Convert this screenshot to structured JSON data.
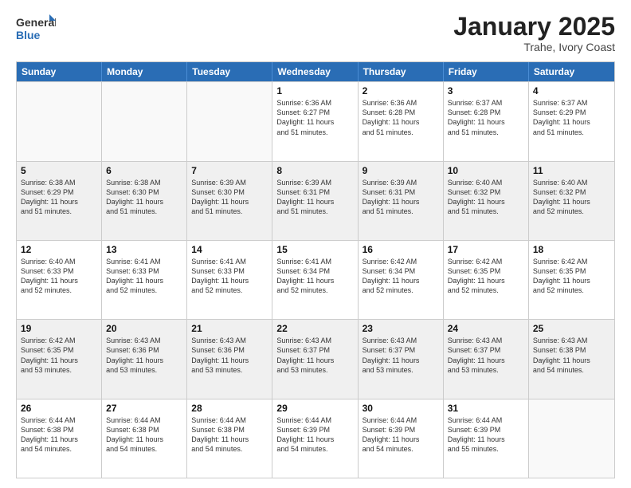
{
  "header": {
    "logo_general": "General",
    "logo_blue": "Blue",
    "month_title": "January 2025",
    "subtitle": "Trahe, Ivory Coast"
  },
  "days_of_week": [
    "Sunday",
    "Monday",
    "Tuesday",
    "Wednesday",
    "Thursday",
    "Friday",
    "Saturday"
  ],
  "weeks": [
    [
      {
        "day": "",
        "lines": [],
        "empty": true
      },
      {
        "day": "",
        "lines": [],
        "empty": true
      },
      {
        "day": "",
        "lines": [],
        "empty": true
      },
      {
        "day": "1",
        "lines": [
          "Sunrise: 6:36 AM",
          "Sunset: 6:27 PM",
          "Daylight: 11 hours",
          "and 51 minutes."
        ]
      },
      {
        "day": "2",
        "lines": [
          "Sunrise: 6:36 AM",
          "Sunset: 6:28 PM",
          "Daylight: 11 hours",
          "and 51 minutes."
        ]
      },
      {
        "day": "3",
        "lines": [
          "Sunrise: 6:37 AM",
          "Sunset: 6:28 PM",
          "Daylight: 11 hours",
          "and 51 minutes."
        ]
      },
      {
        "day": "4",
        "lines": [
          "Sunrise: 6:37 AM",
          "Sunset: 6:29 PM",
          "Daylight: 11 hours",
          "and 51 minutes."
        ]
      }
    ],
    [
      {
        "day": "5",
        "lines": [
          "Sunrise: 6:38 AM",
          "Sunset: 6:29 PM",
          "Daylight: 11 hours",
          "and 51 minutes."
        ]
      },
      {
        "day": "6",
        "lines": [
          "Sunrise: 6:38 AM",
          "Sunset: 6:30 PM",
          "Daylight: 11 hours",
          "and 51 minutes."
        ]
      },
      {
        "day": "7",
        "lines": [
          "Sunrise: 6:39 AM",
          "Sunset: 6:30 PM",
          "Daylight: 11 hours",
          "and 51 minutes."
        ]
      },
      {
        "day": "8",
        "lines": [
          "Sunrise: 6:39 AM",
          "Sunset: 6:31 PM",
          "Daylight: 11 hours",
          "and 51 minutes."
        ]
      },
      {
        "day": "9",
        "lines": [
          "Sunrise: 6:39 AM",
          "Sunset: 6:31 PM",
          "Daylight: 11 hours",
          "and 51 minutes."
        ]
      },
      {
        "day": "10",
        "lines": [
          "Sunrise: 6:40 AM",
          "Sunset: 6:32 PM",
          "Daylight: 11 hours",
          "and 51 minutes."
        ]
      },
      {
        "day": "11",
        "lines": [
          "Sunrise: 6:40 AM",
          "Sunset: 6:32 PM",
          "Daylight: 11 hours",
          "and 52 minutes."
        ]
      }
    ],
    [
      {
        "day": "12",
        "lines": [
          "Sunrise: 6:40 AM",
          "Sunset: 6:33 PM",
          "Daylight: 11 hours",
          "and 52 minutes."
        ]
      },
      {
        "day": "13",
        "lines": [
          "Sunrise: 6:41 AM",
          "Sunset: 6:33 PM",
          "Daylight: 11 hours",
          "and 52 minutes."
        ]
      },
      {
        "day": "14",
        "lines": [
          "Sunrise: 6:41 AM",
          "Sunset: 6:33 PM",
          "Daylight: 11 hours",
          "and 52 minutes."
        ]
      },
      {
        "day": "15",
        "lines": [
          "Sunrise: 6:41 AM",
          "Sunset: 6:34 PM",
          "Daylight: 11 hours",
          "and 52 minutes."
        ]
      },
      {
        "day": "16",
        "lines": [
          "Sunrise: 6:42 AM",
          "Sunset: 6:34 PM",
          "Daylight: 11 hours",
          "and 52 minutes."
        ]
      },
      {
        "day": "17",
        "lines": [
          "Sunrise: 6:42 AM",
          "Sunset: 6:35 PM",
          "Daylight: 11 hours",
          "and 52 minutes."
        ]
      },
      {
        "day": "18",
        "lines": [
          "Sunrise: 6:42 AM",
          "Sunset: 6:35 PM",
          "Daylight: 11 hours",
          "and 52 minutes."
        ]
      }
    ],
    [
      {
        "day": "19",
        "lines": [
          "Sunrise: 6:42 AM",
          "Sunset: 6:35 PM",
          "Daylight: 11 hours",
          "and 53 minutes."
        ]
      },
      {
        "day": "20",
        "lines": [
          "Sunrise: 6:43 AM",
          "Sunset: 6:36 PM",
          "Daylight: 11 hours",
          "and 53 minutes."
        ]
      },
      {
        "day": "21",
        "lines": [
          "Sunrise: 6:43 AM",
          "Sunset: 6:36 PM",
          "Daylight: 11 hours",
          "and 53 minutes."
        ]
      },
      {
        "day": "22",
        "lines": [
          "Sunrise: 6:43 AM",
          "Sunset: 6:37 PM",
          "Daylight: 11 hours",
          "and 53 minutes."
        ]
      },
      {
        "day": "23",
        "lines": [
          "Sunrise: 6:43 AM",
          "Sunset: 6:37 PM",
          "Daylight: 11 hours",
          "and 53 minutes."
        ]
      },
      {
        "day": "24",
        "lines": [
          "Sunrise: 6:43 AM",
          "Sunset: 6:37 PM",
          "Daylight: 11 hours",
          "and 53 minutes."
        ]
      },
      {
        "day": "25",
        "lines": [
          "Sunrise: 6:43 AM",
          "Sunset: 6:38 PM",
          "Daylight: 11 hours",
          "and 54 minutes."
        ]
      }
    ],
    [
      {
        "day": "26",
        "lines": [
          "Sunrise: 6:44 AM",
          "Sunset: 6:38 PM",
          "Daylight: 11 hours",
          "and 54 minutes."
        ]
      },
      {
        "day": "27",
        "lines": [
          "Sunrise: 6:44 AM",
          "Sunset: 6:38 PM",
          "Daylight: 11 hours",
          "and 54 minutes."
        ]
      },
      {
        "day": "28",
        "lines": [
          "Sunrise: 6:44 AM",
          "Sunset: 6:38 PM",
          "Daylight: 11 hours",
          "and 54 minutes."
        ]
      },
      {
        "day": "29",
        "lines": [
          "Sunrise: 6:44 AM",
          "Sunset: 6:39 PM",
          "Daylight: 11 hours",
          "and 54 minutes."
        ]
      },
      {
        "day": "30",
        "lines": [
          "Sunrise: 6:44 AM",
          "Sunset: 6:39 PM",
          "Daylight: 11 hours",
          "and 54 minutes."
        ]
      },
      {
        "day": "31",
        "lines": [
          "Sunrise: 6:44 AM",
          "Sunset: 6:39 PM",
          "Daylight: 11 hours",
          "and 55 minutes."
        ]
      },
      {
        "day": "",
        "lines": [],
        "empty": true
      }
    ]
  ]
}
